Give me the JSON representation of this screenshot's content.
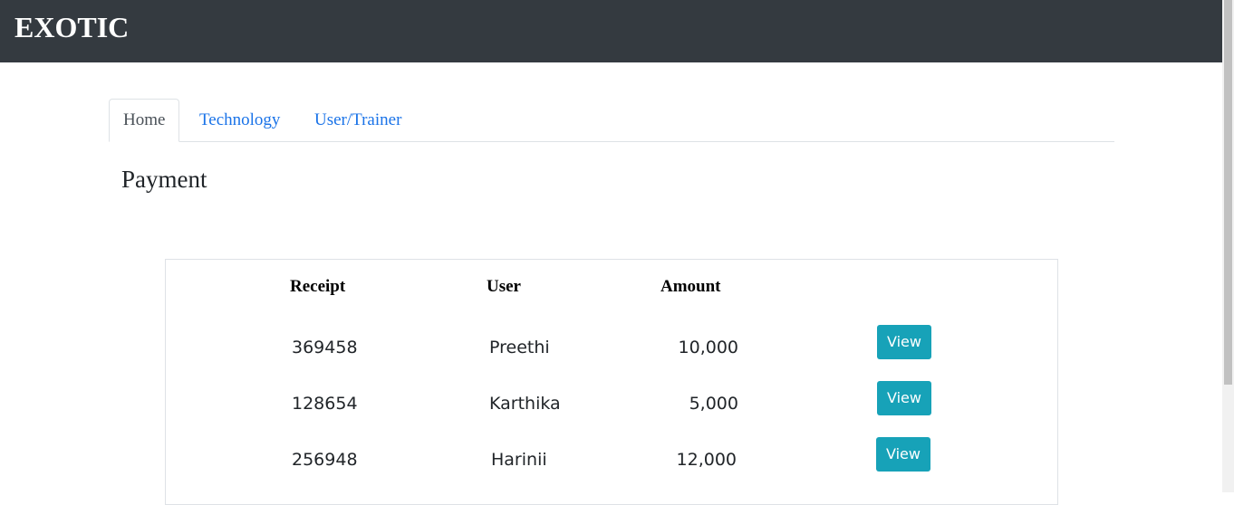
{
  "navbar": {
    "brand": "EXOTIC"
  },
  "tabs": [
    {
      "label": "Home",
      "active": true
    },
    {
      "label": "Technology",
      "active": false
    },
    {
      "label": "User/Trainer",
      "active": false
    }
  ],
  "page": {
    "title": "Payment"
  },
  "table": {
    "headers": {
      "receipt": "Receipt",
      "user": "User",
      "amount": "Amount"
    },
    "rows": [
      {
        "receipt": "369458",
        "user": "Preethi",
        "amount": "10,000",
        "action": "View"
      },
      {
        "receipt": "128654",
        "user": "Karthika",
        "amount": "5,000",
        "action": "View"
      },
      {
        "receipt": "256948",
        "user": "Harinii",
        "amount": "12,000",
        "action": "View"
      }
    ]
  },
  "colors": {
    "navbar": "#343a40",
    "link": "#1a73e8",
    "button": "#17a2b8"
  }
}
